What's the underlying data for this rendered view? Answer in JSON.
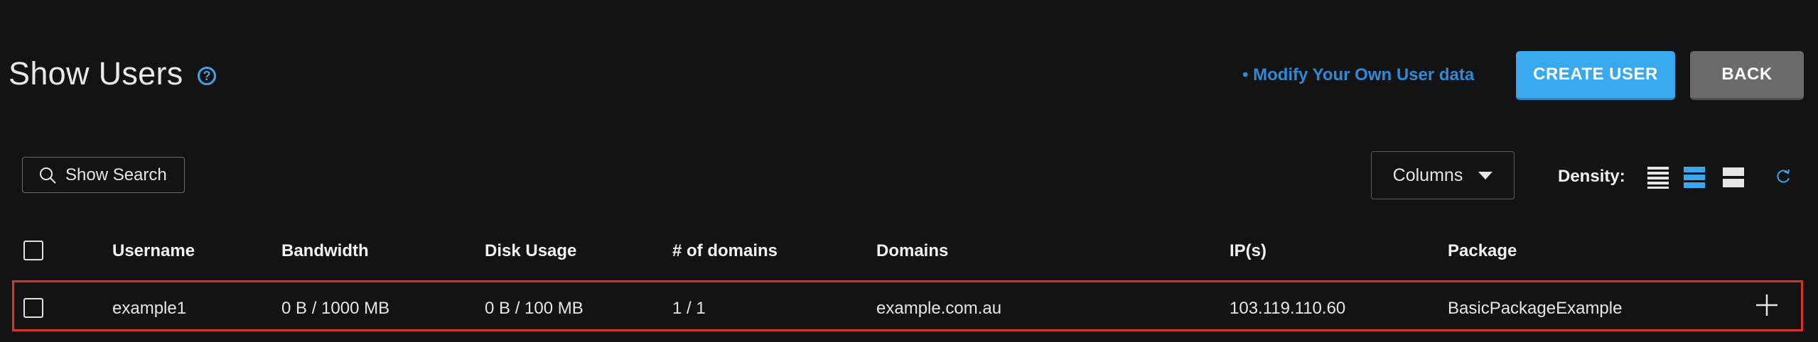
{
  "header": {
    "title": "Show Users",
    "help_icon": "question-circle-icon",
    "modify_link": "• Modify Your Own User data",
    "create_label": "CREATE USER",
    "back_label": "BACK"
  },
  "toolbar": {
    "search_label": "Show Search",
    "columns_label": "Columns",
    "density_label": "Density:",
    "density_options": [
      "compact",
      "standard",
      "comfortable"
    ],
    "density_selected": "standard"
  },
  "table": {
    "columns": [
      "Username",
      "Bandwidth",
      "Disk Usage",
      "# of domains",
      "Domains",
      "IP(s)",
      "Package"
    ],
    "rows": [
      {
        "username": "example1",
        "bandwidth": "0 B / 1000 MB",
        "disk_usage": "0 B / 100 MB",
        "domains_count": "1 / 1",
        "domains": "example.com.au",
        "ips": "103.119.110.60",
        "package": "BasicPackageExample"
      }
    ]
  },
  "colors": {
    "accent": "#3aa8ef",
    "link": "#2e8ad6",
    "highlight_border": "#d9342b",
    "background": "#131313"
  }
}
